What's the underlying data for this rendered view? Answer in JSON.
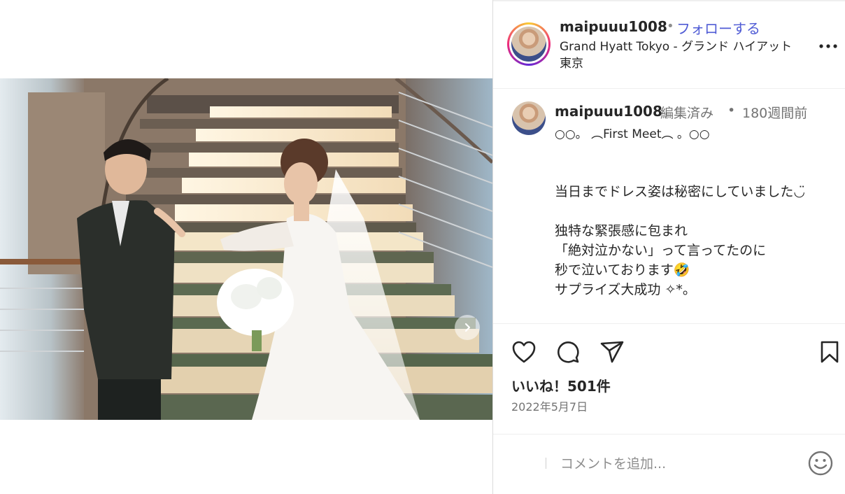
{
  "post": {
    "username": "maipuuu1008",
    "separator": "•",
    "follow_label": "フォローする",
    "location": "Grand Hyatt Tokyo - グランド ハイアット 東京",
    "more_label": "•••",
    "image_alt": "Bride placing hand on groom's shoulder on illuminated staircase",
    "carousel_dots": 3,
    "carousel_active": 0
  },
  "caption": {
    "username": "maipuuu1008",
    "edited_label": "編集済み",
    "time_sep": "•",
    "time": "180週間前",
    "lines": [
      "○○。 ︵First Meet︵ 。○○",
      "当日までドレス姿は秘密にしていました◡̈",
      "独特な緊張感に包まれ",
      "「絶対泣かない」って言ってたのに",
      "秒で泣いております🤣",
      "サプライズ大成功 ✧*。"
    ]
  },
  "stats": {
    "likes": "いいね！501件",
    "date": "2022年5月7日"
  },
  "comment": {
    "placeholder": "コメントを追加..."
  },
  "icons": {
    "like": "heart-icon",
    "comment": "comment-icon",
    "share": "send-icon",
    "save": "bookmark-icon",
    "next": "chevron-right-icon",
    "tags": "user-tag-icon",
    "emoji": "emoji-icon"
  },
  "colors": {
    "follow": "#4f5bd5",
    "secondary_text": "#737373",
    "border": "#dbdbdb"
  }
}
